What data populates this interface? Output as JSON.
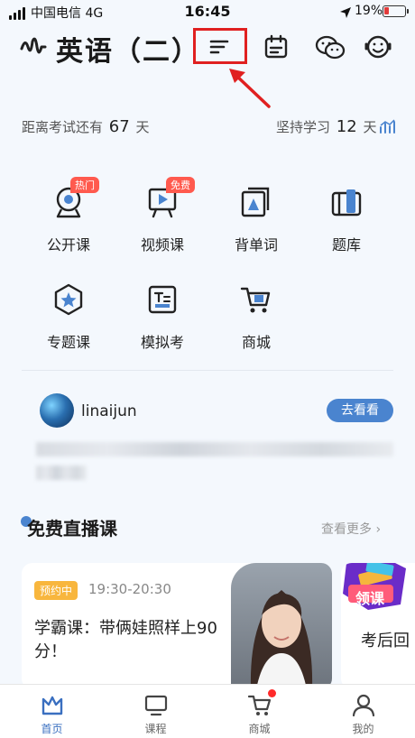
{
  "status_bar": {
    "carrier": "中国电信  4G",
    "time": "16:45",
    "battery": "19%"
  },
  "header": {
    "title": "英语（二）",
    "icons": [
      "waveform-icon",
      "menu-lines-icon",
      "calendar-icon",
      "wechat-icon",
      "smiley-service-icon"
    ]
  },
  "stats": {
    "exam_prefix": "距离考试还有",
    "exam_days": "67",
    "exam_suffix": "天",
    "study_prefix": "坚持学习",
    "study_days": "12",
    "study_suffix": "天"
  },
  "grid": [
    {
      "label": "公开课",
      "badge": "热门",
      "icon": "webcam-icon"
    },
    {
      "label": "视频课",
      "badge": "免费",
      "icon": "video-board-icon"
    },
    {
      "label": "背单词",
      "badge": "",
      "icon": "word-card-icon"
    },
    {
      "label": "题库",
      "badge": "",
      "icon": "question-bank-icon"
    },
    {
      "label": "专题课",
      "badge": "",
      "icon": "star-hexagon-icon"
    },
    {
      "label": "模拟考",
      "badge": "",
      "icon": "exam-sheet-icon"
    },
    {
      "label": "商城",
      "badge": "",
      "icon": "cart-icon"
    }
  ],
  "user": {
    "name": "linaijun",
    "button": "去看看"
  },
  "live": {
    "title": "免费直播课",
    "more": "查看更多 ›",
    "card": {
      "tag": "预约中",
      "time": "19:30-20:30",
      "title": "学霸课：带俩娃照样上90分！"
    },
    "card2": {
      "badge": "领课",
      "title": "考后回"
    }
  },
  "tabbar": [
    {
      "label": "首页",
      "active": true,
      "icon": "home-crown-icon"
    },
    {
      "label": "课程",
      "active": false,
      "icon": "monitor-icon"
    },
    {
      "label": "商城",
      "active": false,
      "icon": "cart-icon"
    },
    {
      "label": "我的",
      "active": false,
      "icon": "user-icon"
    }
  ],
  "colors": {
    "accent": "#4a84cf",
    "highlight": "#e02020",
    "background": "#f4f8fd"
  }
}
